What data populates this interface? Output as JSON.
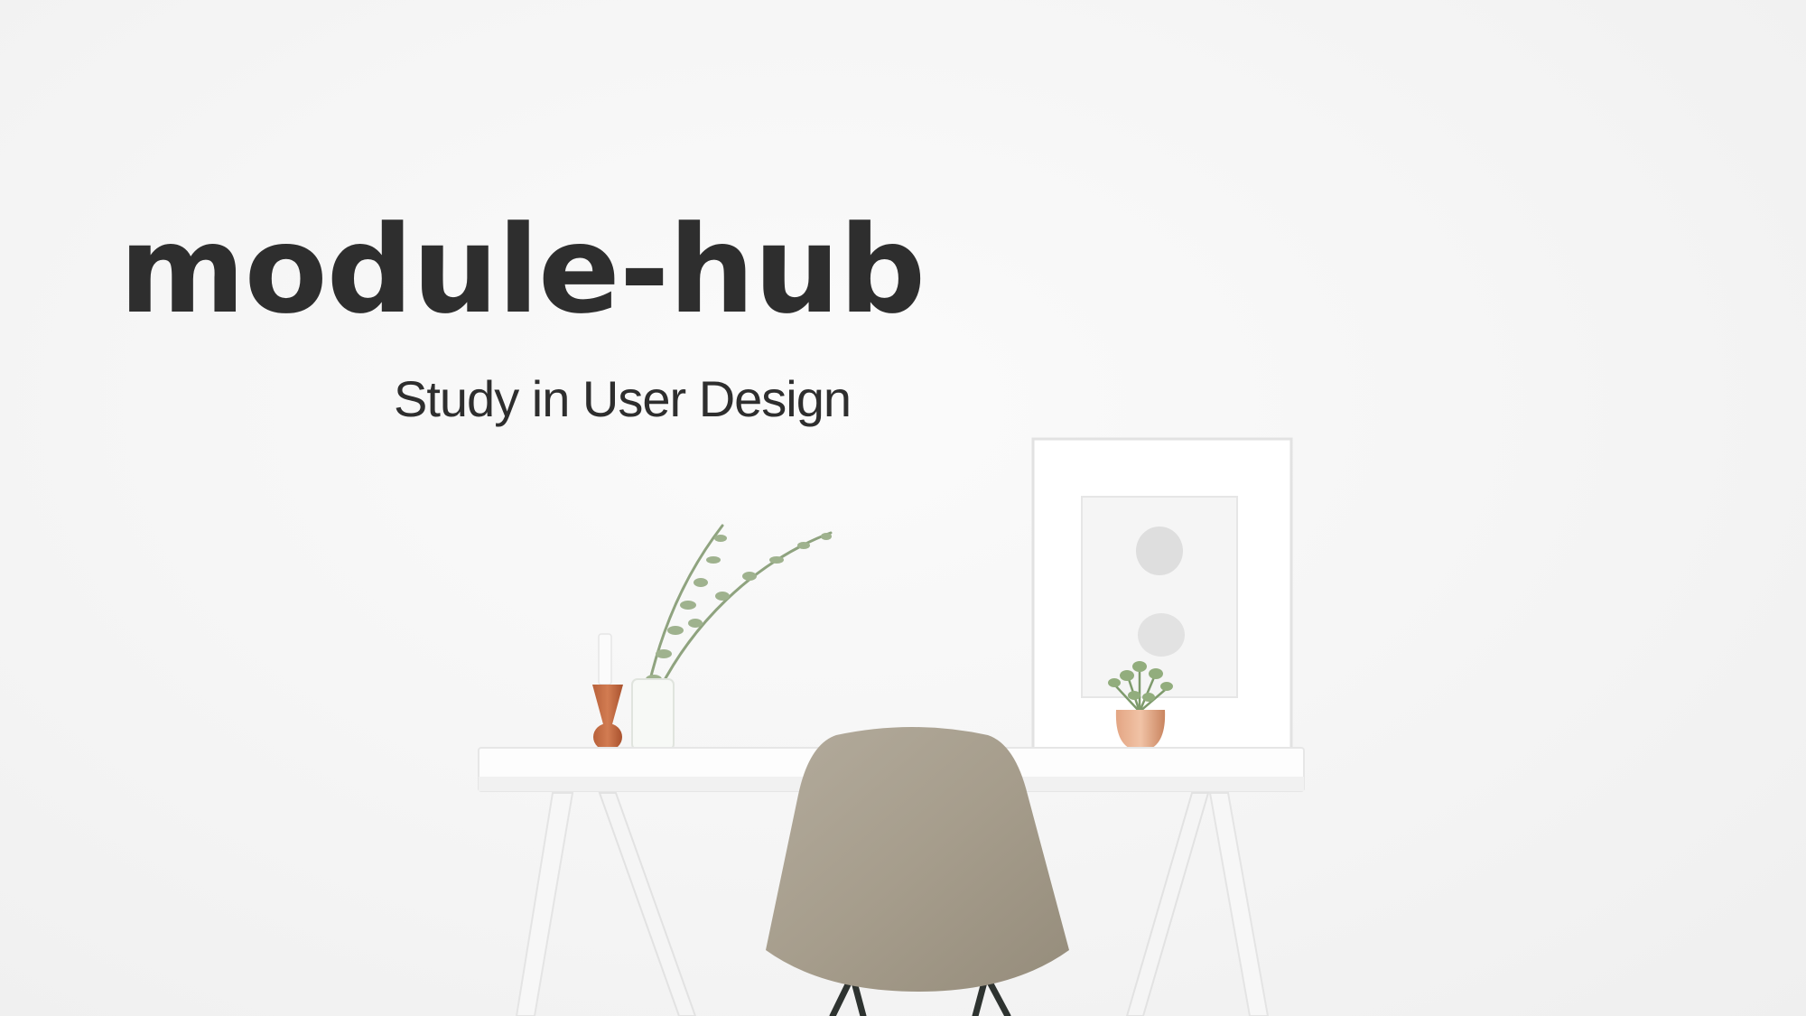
{
  "hero": {
    "title": "module-hub",
    "subtitle": "Study in User Design"
  },
  "colors": {
    "background": "#f3f3f3",
    "heading_text": "#2e2e2e",
    "chair": "#a79e8d",
    "copper": "#c9744a",
    "greenery": "#8fa37f"
  }
}
